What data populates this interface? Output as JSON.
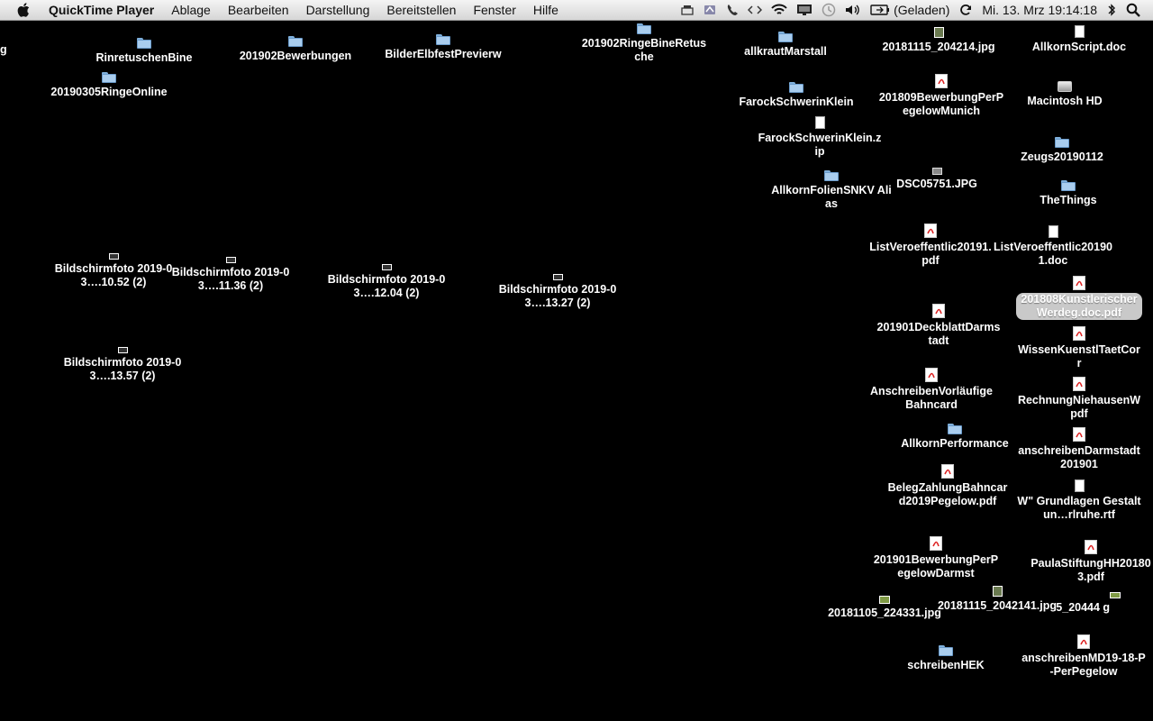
{
  "menubar": {
    "app_name": "QuickTime Player",
    "menus": [
      "Ablage",
      "Bearbeiten",
      "Darstellung",
      "Bereitstellen",
      "Fenster",
      "Hilfe"
    ],
    "battery_status": "(Geladen)",
    "clock": "Mi. 13. Mrz  19:14:18"
  },
  "desktop": {
    "edge_label": "g",
    "items": [
      {
        "name": "RinretuschenBine",
        "icon": "folder-icon"
      },
      {
        "name": "20190305RingeOnline",
        "icon": "folder-icon"
      },
      {
        "name": "201902Bewerbungen",
        "icon": "folder-icon"
      },
      {
        "name": "BilderElbfestPrevierw",
        "icon": "folder-icon"
      },
      {
        "name": "201902RingeBineRetusche",
        "icon": "folder-icon"
      },
      {
        "name": "allkrautMarstall",
        "icon": "folder-icon"
      },
      {
        "name": "20181115_204214.jpg",
        "icon": "image-icon"
      },
      {
        "name": "AllkornScript.doc",
        "icon": "doc-icon"
      },
      {
        "name": "FarockSchwerinKlein",
        "icon": "folder-icon"
      },
      {
        "name": "201809BewerbungPerPegelowMunich",
        "icon": "pdf-icon"
      },
      {
        "name": "Macintosh HD",
        "icon": "hard-drive-icon"
      },
      {
        "name": "FarockSchwerinKlein.zip",
        "icon": "zip-icon"
      },
      {
        "name": "Zeugs20190112",
        "icon": "folder-icon"
      },
      {
        "name": "AllkornFolienSNKV Alias",
        "icon": "alias-folder-icon"
      },
      {
        "name": "DSC05751.JPG",
        "icon": "image-icon"
      },
      {
        "name": "TheThings",
        "icon": "folder-icon"
      },
      {
        "name": "ListVeroeffentlic20191.pdf",
        "icon": "pdf-icon"
      },
      {
        "name": "ListVeroeffentlic201901.doc",
        "icon": "doc-icon"
      },
      {
        "name": "201808KunstlerischerWerdeg.doc.pdf",
        "icon": "pdf-icon"
      },
      {
        "name": "201901DeckblattDarmstadt",
        "icon": "pdf-icon"
      },
      {
        "name": "WissenKuenstlTaetCorr",
        "icon": "pdf-icon"
      },
      {
        "name": "AnschreibenVorläufigeBahncard",
        "icon": "pdf-icon"
      },
      {
        "name": "RechnungNiehausenW pdf",
        "icon": "pdf-icon"
      },
      {
        "name": "AllkornPerformance",
        "icon": "folder-icon"
      },
      {
        "name": "anschreibenDarmstadt201901",
        "icon": "pdf-icon"
      },
      {
        "name": "BelegZahlungBahncard2019Pegelow.pdf",
        "icon": "pdf-icon"
      },
      {
        "name": "W\" Grundlagen Gestaltun…rlruhe.rtf",
        "icon": "rtf-icon"
      },
      {
        "name": "201901BewerbungPerPegelowDarmst",
        "icon": "pdf-icon"
      },
      {
        "name": "PaulaStiftungHH201803.pdf",
        "icon": "pdf-icon"
      },
      {
        "name": "20181115_20444 g",
        "icon": "image-icon"
      },
      {
        "name": "20181105_224331.jpg",
        "icon": "image-icon"
      },
      {
        "name": "20181115_2042141.jpg",
        "icon": "image-icon"
      },
      {
        "name": "schreibenHEK",
        "icon": "folder-icon"
      },
      {
        "name": "anschreibenMD19-18-P-PerPegelow",
        "icon": "pdf-icon"
      },
      {
        "name": "Bildschirmfoto 2019-03….10.52 (2)",
        "icon": "screenshot-icon"
      },
      {
        "name": "Bildschirmfoto 2019-03….11.36 (2)",
        "icon": "screenshot-icon"
      },
      {
        "name": "Bildschirmfoto 2019-03….12.04 (2)",
        "icon": "screenshot-icon"
      },
      {
        "name": "Bildschirmfoto 2019-03….13.27 (2)",
        "icon": "screenshot-icon"
      },
      {
        "name": "Bildschirmfoto 2019-03….13.57 (2)",
        "icon": "screenshot-icon"
      }
    ]
  }
}
